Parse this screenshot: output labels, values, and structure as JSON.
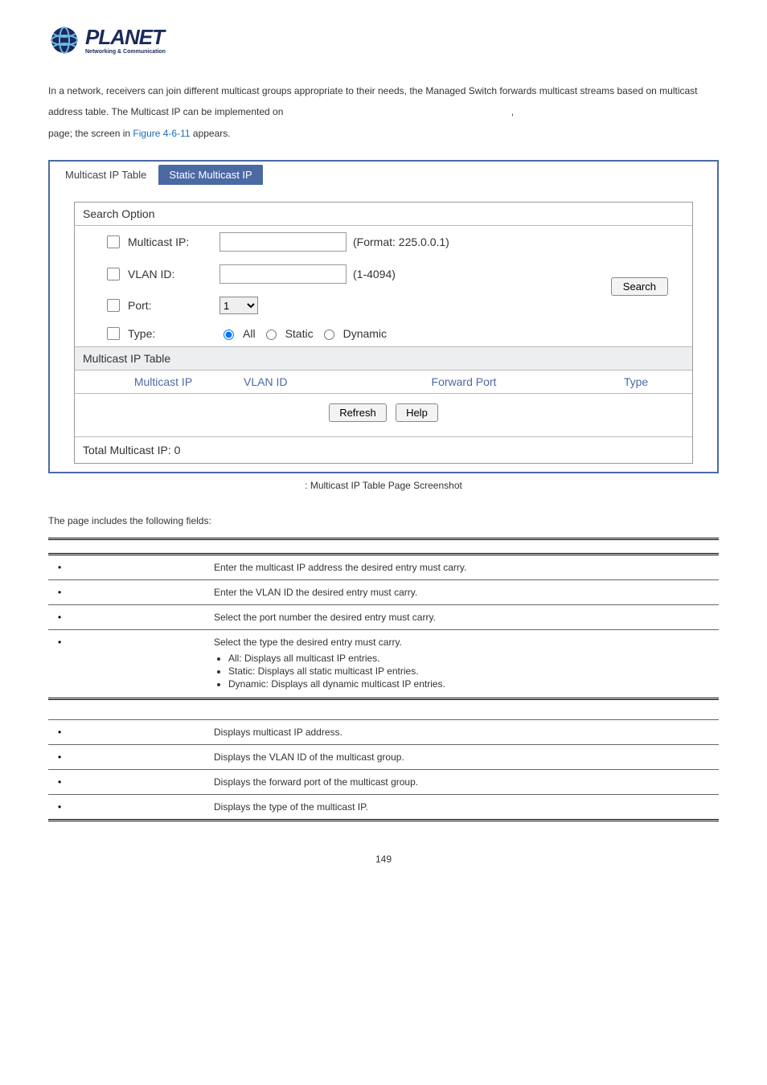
{
  "logo": {
    "main": "PLANET",
    "sub": "Networking & Communication"
  },
  "intro": {
    "line1_a": "In a network, receivers can join different multicast groups appropriate to their needs, the Managed Switch forwards multicast",
    "line1_b": "streams based on multicast address table. The Multicast IP can be implemented on",
    "comma": ",",
    "line2_a": "page; the screen in ",
    "figref": "Figure 4-6-11",
    "line2_b": " appears."
  },
  "panel": {
    "tabs": {
      "t1": "Multicast IP Table",
      "t2": "Static Multicast IP"
    },
    "search_header": "Search Option",
    "rows": {
      "mip_label": "Multicast IP:",
      "mip_hint": "(Format: 225.0.0.1)",
      "vlan_label": "VLAN ID:",
      "vlan_hint": "(1-4094)",
      "port_label": "Port:",
      "port_value": "1",
      "type_label": "Type:",
      "type_all": "All",
      "type_static": "Static",
      "type_dynamic": "Dynamic"
    },
    "search_btn": "Search",
    "sub_header": "Multicast IP Table",
    "thead": {
      "c1": "Multicast IP",
      "c2": "VLAN ID",
      "c3": "Forward Port",
      "c4": "Type"
    },
    "btns": {
      "refresh": "Refresh",
      "help": "Help"
    },
    "total": "Total Multicast IP: 0"
  },
  "figcap": ": Multicast IP Table Page Screenshot",
  "fields_intro": "The page includes the following fields:",
  "tbl1": {
    "h1": "",
    "h2": "",
    "r1_desc": "Enter the multicast IP address the desired entry must carry.",
    "r2_desc": "Enter the VLAN ID the desired entry must carry.",
    "r3_desc": "Select the port number the desired entry must carry.",
    "r4_desc": "Select the type the desired entry must carry.",
    "r4_b1": "All: Displays all multicast IP entries.",
    "r4_b2": "Static: Displays all static multicast IP entries.",
    "r4_b3": "Dynamic: Displays all dynamic multicast IP entries."
  },
  "tbl2": {
    "r1_desc": "Displays multicast IP address.",
    "r2_desc": "Displays the VLAN ID of the multicast group.",
    "r3_desc": "Displays the forward port of the multicast group.",
    "r4_desc": "Displays the type of the multicast IP."
  },
  "pgnum": "149"
}
